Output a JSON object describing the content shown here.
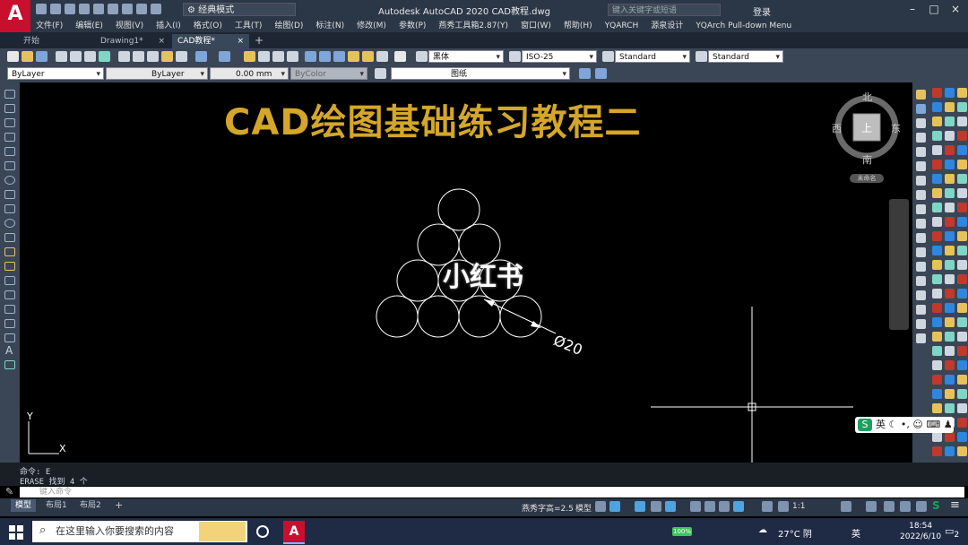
{
  "app": {
    "title": "Autodesk AutoCAD 2020    CAD教程.dwg",
    "logo_letter": "A",
    "workspace": "经典模式",
    "search_placeholder": "键入关键字或短语",
    "login": "登录",
    "window_controls": [
      "–",
      "□",
      "×"
    ]
  },
  "menus": [
    "文件(F)",
    "编辑(E)",
    "视图(V)",
    "插入(I)",
    "格式(O)",
    "工具(T)",
    "绘图(D)",
    "标注(N)",
    "修改(M)",
    "参数(P)",
    "燕秀工具箱2.87(Y)",
    "窗口(W)",
    "帮助(H)",
    "YQARCH",
    "源泉设计",
    "YQArch Pull-down Menu"
  ],
  "tabs": [
    {
      "label": "开始",
      "active": false
    },
    {
      "label": "Drawing1*",
      "active": false
    },
    {
      "label": "CAD教程*",
      "active": true
    }
  ],
  "toolbar": {
    "text_style_font": "黑体",
    "dim_style": "ISO-25",
    "table_style": "Standard",
    "multileader_style": "Standard",
    "layer_color": "ByLayer",
    "linetype": "ByLayer",
    "lineweight": "0.00 mm",
    "plot_style": "ByColor",
    "layer_name": "图纸"
  },
  "drawing": {
    "heading": "CAD绘图基础练习教程二",
    "watermark": "小红书",
    "dimension_text": "Ø20",
    "ucs_x": "X",
    "ucs_y": "Y"
  },
  "viewcube": {
    "north": "北",
    "south": "南",
    "east": "东",
    "west": "西",
    "face": "上",
    "wcs": "未命名"
  },
  "ime": {
    "label": "英"
  },
  "command": {
    "history": [
      "命令: E",
      "ERASE 找到 4 个"
    ],
    "placeholder": "键入命令"
  },
  "layout_tabs": [
    {
      "label": "模型",
      "active": true
    },
    {
      "label": "布局1",
      "active": false
    },
    {
      "label": "布局2",
      "active": false
    }
  ],
  "status": {
    "text_height": "燕秀字高=2.5",
    "space": "模型",
    "scale": "1:1"
  },
  "taskbar": {
    "search_placeholder": "在这里输入你要搜索的内容",
    "battery": "100%",
    "weather": "27°C 阴",
    "lang": "英",
    "time": "18:54",
    "date": "2022/6/10",
    "notification_count": "2"
  },
  "colors": {
    "heading": "#d4a62a",
    "logo": "#c8102e",
    "chrome": "#2b3646",
    "toolbar": "#3a4656"
  }
}
